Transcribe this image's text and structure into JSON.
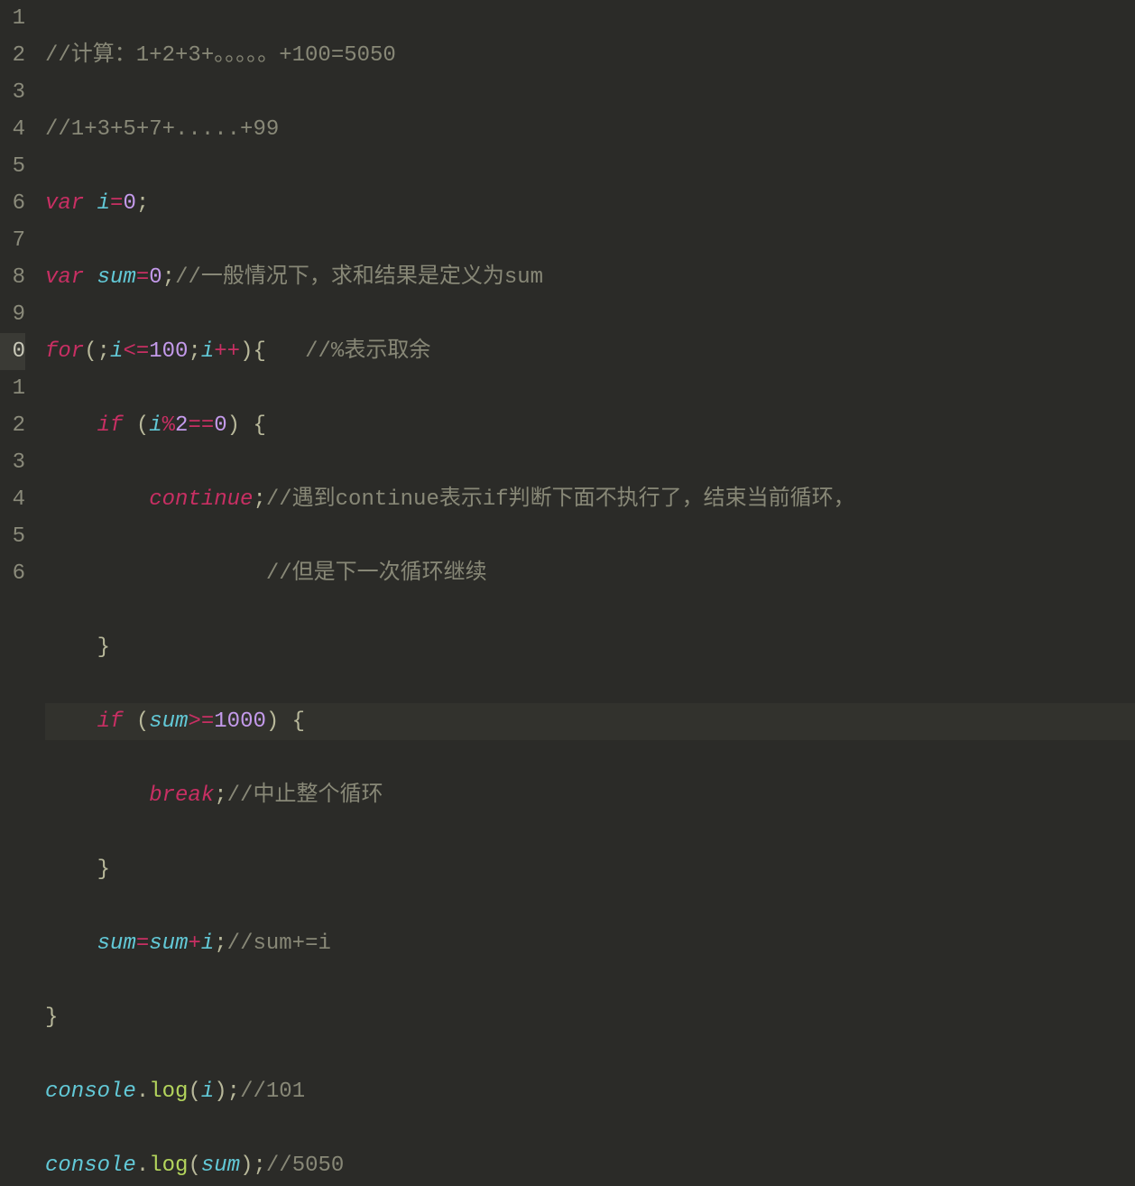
{
  "activeLine": 10,
  "gutter": [
    "1",
    "2",
    "3",
    "4",
    "5",
    "6",
    "7",
    "8",
    "9",
    "0",
    "1",
    "2",
    "3",
    "4",
    "5",
    "6"
  ],
  "code": {
    "l1": {
      "cmt": "//计算：1+2+3+。。。。。+100=5050"
    },
    "l2": {
      "cmt": "//1+3+5+7+.....+99"
    },
    "l3": {
      "kw": "var",
      "sp": " ",
      "v": "i",
      "op": "=",
      "n": "0",
      "sc": ";"
    },
    "l4": {
      "kw": "var",
      "sp": " ",
      "v": "sum",
      "op": "=",
      "n": "0",
      "sc": ";",
      "cmt": "//一般情况下，求和结果是定义为sum"
    },
    "l5": {
      "kw": "for",
      "p1": "(;",
      "v": "i",
      "op1": "<=",
      "n1": "100",
      "sc1": ";",
      "v2": "i",
      "op2": "++",
      "p2": "){   ",
      "cmt": "//%表示取余"
    },
    "l6": {
      "ind": "    ",
      "kw": "if",
      "sp": " ",
      "p1": "(",
      "v": "i",
      "op": "%",
      "n1": "2",
      "op2": "==",
      "n2": "0",
      "p2": ") {"
    },
    "l7": {
      "ind": "        ",
      "kw": "continue",
      "sc": ";",
      "cmt": "//遇到continue表示if判断下面不执行了，结束当前循环，"
    },
    "l8": {
      "ind": "                 ",
      "cmt": "//但是下一次循环继续"
    },
    "l9": {
      "ind": "    ",
      "p": "}"
    },
    "l10": {
      "ind": "    ",
      "kw": "if",
      "sp": " ",
      "p1": "(",
      "v": "sum",
      "op": ">=",
      "n": "1000",
      "p2": ") {"
    },
    "l11": {
      "ind": "        ",
      "kw": "break",
      "sc": ";",
      "cmt": "//中止整个循环"
    },
    "l12": {
      "ind": "    ",
      "p": "}"
    },
    "l13": {
      "ind": "    ",
      "v1": "sum",
      "op1": "=",
      "v2": "sum",
      "op2": "+",
      "v3": "i",
      "sc": ";",
      "cmt": "//sum+=i"
    },
    "l14": {
      "p": "}"
    },
    "l15": {
      "obj": "console",
      "dot": ".",
      "fn": "log",
      "p1": "(",
      "v": "i",
      "p2": ");",
      "cmt": "//101"
    },
    "l16": {
      "obj": "console",
      "dot": ".",
      "fn": "log",
      "p1": "(",
      "v": "sum",
      "p2": ");",
      "cmt": "//5050"
    }
  }
}
